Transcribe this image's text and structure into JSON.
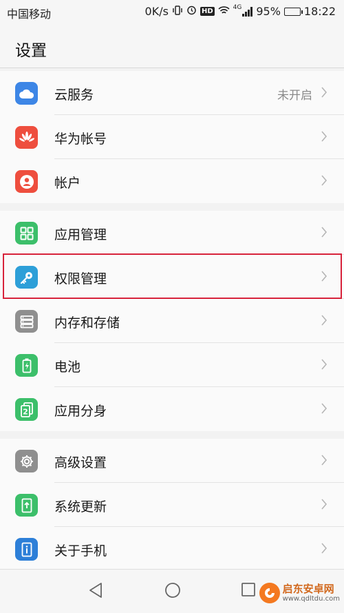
{
  "status_bar": {
    "carrier": "中国移动",
    "speed": "0K/s",
    "hd": "HD",
    "network": "4G",
    "battery_percent": "95%",
    "battery_level": 0.95,
    "time": "18:22"
  },
  "header": {
    "title": "设置"
  },
  "groups": [
    {
      "items": [
        {
          "label": "云服务",
          "value": "未开启",
          "icon": "cloud-icon",
          "color": "#3d86e6"
        },
        {
          "label": "华为帐号",
          "value": "",
          "icon": "huawei-logo-icon",
          "color": "#ee4e3e"
        },
        {
          "label": "帐户",
          "value": "",
          "icon": "user-icon",
          "color": "#ee4e3e"
        }
      ]
    },
    {
      "items": [
        {
          "label": "应用管理",
          "value": "",
          "icon": "apps-grid-icon",
          "color": "#3cbf6a"
        },
        {
          "label": "权限管理",
          "value": "",
          "icon": "key-icon",
          "color": "#2d9fd8"
        },
        {
          "label": "内存和存储",
          "value": "",
          "icon": "storage-icon",
          "color": "#8f8f8f"
        },
        {
          "label": "电池",
          "value": "",
          "icon": "battery-icon",
          "color": "#3cbf6a"
        },
        {
          "label": "应用分身",
          "value": "",
          "icon": "app-twin-icon",
          "color": "#3cbf6a"
        }
      ]
    },
    {
      "items": [
        {
          "label": "高级设置",
          "value": "",
          "icon": "gear-icon",
          "color": "#8f8f8f"
        },
        {
          "label": "系统更新",
          "value": "",
          "icon": "system-update-icon",
          "color": "#3cbf6a"
        },
        {
          "label": "关于手机",
          "value": "",
          "icon": "info-icon",
          "color": "#2d7fd8"
        }
      ]
    }
  ],
  "highlight_color": "#d7223a",
  "watermark": {
    "name": "启东安卓网",
    "url": "www.qdltdu.com"
  }
}
